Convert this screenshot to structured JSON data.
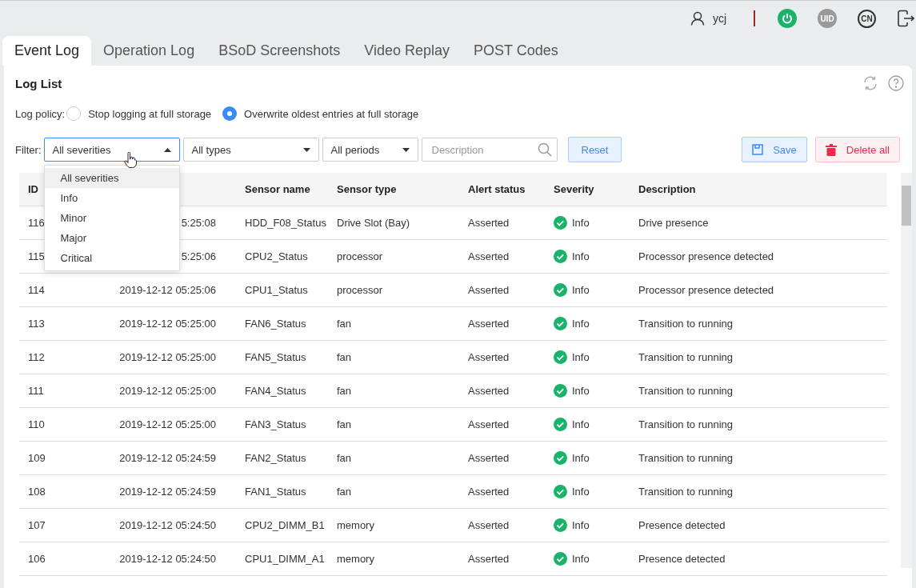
{
  "header": {
    "user": "ycj",
    "uid_label": "UID",
    "language": "CN",
    "power_on": true
  },
  "tabs": [
    {
      "label": "Event Log",
      "selected": true
    },
    {
      "label": "Operation Log",
      "selected": false
    },
    {
      "label": "BSoD Screenshots",
      "selected": false
    },
    {
      "label": "Video Replay",
      "selected": false
    },
    {
      "label": "POST Codes",
      "selected": false
    }
  ],
  "panel": {
    "title": "Log List",
    "policy": {
      "label": "Log policy:",
      "options": [
        {
          "label": "Stop logging at full storage",
          "selected": false
        },
        {
          "label": "Overwrite oldest entries at full storage",
          "selected": true
        }
      ]
    },
    "filter": {
      "label": "Filter:",
      "selects": [
        {
          "value": "All severities",
          "expanded": true
        },
        {
          "value": "All types",
          "expanded": false
        },
        {
          "value": "All periods",
          "expanded": false
        }
      ],
      "search": {
        "placeholder": "Description"
      },
      "menu": [
        {
          "label": "All severities",
          "selected": true
        },
        {
          "label": "Info",
          "selected": false
        },
        {
          "label": "Minor",
          "selected": false
        },
        {
          "label": "Major",
          "selected": false
        },
        {
          "label": "Critical",
          "selected": false
        }
      ]
    },
    "buttons": [
      {
        "label": "Reset",
        "kind": "reset"
      },
      {
        "label": "Save",
        "kind": "save"
      },
      {
        "label": "Delete all",
        "kind": "delete"
      }
    ]
  },
  "table": {
    "columns": [
      "ID",
      "Sensor name",
      "Sensor type",
      "Alert status",
      "Severity",
      "Description"
    ],
    "rows": [
      {
        "id": "116",
        "time": "5:25:08",
        "sensor": "HDD_F08_Status",
        "type": "Drive Slot (Bay)",
        "alert": "Asserted",
        "severity": "Info",
        "description": "Drive presence"
      },
      {
        "id": "115",
        "time": "5:25:06",
        "sensor": "CPU2_Status",
        "type": "processor",
        "alert": "Asserted",
        "severity": "Info",
        "description": "Processor presence detected"
      },
      {
        "id": "114",
        "time": "2019-12-12 05:25:06",
        "sensor": "CPU1_Status",
        "type": "processor",
        "alert": "Asserted",
        "severity": "Info",
        "description": "Processor presence detected"
      },
      {
        "id": "113",
        "time": "2019-12-12 05:25:00",
        "sensor": "FAN6_Status",
        "type": "fan",
        "alert": "Asserted",
        "severity": "Info",
        "description": "Transition to running"
      },
      {
        "id": "112",
        "time": "2019-12-12 05:25:00",
        "sensor": "FAN5_Status",
        "type": "fan",
        "alert": "Asserted",
        "severity": "Info",
        "description": "Transition to running"
      },
      {
        "id": "111",
        "time": "2019-12-12 05:25:00",
        "sensor": "FAN4_Status",
        "type": "fan",
        "alert": "Asserted",
        "severity": "Info",
        "description": "Transition to running"
      },
      {
        "id": "110",
        "time": "2019-12-12 05:25:00",
        "sensor": "FAN3_Status",
        "type": "fan",
        "alert": "Asserted",
        "severity": "Info",
        "description": "Transition to running"
      },
      {
        "id": "109",
        "time": "2019-12-12 05:24:59",
        "sensor": "FAN2_Status",
        "type": "fan",
        "alert": "Asserted",
        "severity": "Info",
        "description": "Transition to running"
      },
      {
        "id": "108",
        "time": "2019-12-12 05:24:59",
        "sensor": "FAN1_Status",
        "type": "fan",
        "alert": "Asserted",
        "severity": "Info",
        "description": "Transition to running"
      },
      {
        "id": "107",
        "time": "2019-12-12 05:24:50",
        "sensor": "CPU2_DIMM_B1",
        "type": "memory",
        "alert": "Asserted",
        "severity": "Info",
        "description": "Presence detected"
      },
      {
        "id": "106",
        "time": "2019-12-12 05:24:50",
        "sensor": "CPU1_DIMM_A1",
        "type": "memory",
        "alert": "Asserted",
        "severity": "Info",
        "description": "Presence detected"
      }
    ]
  }
}
